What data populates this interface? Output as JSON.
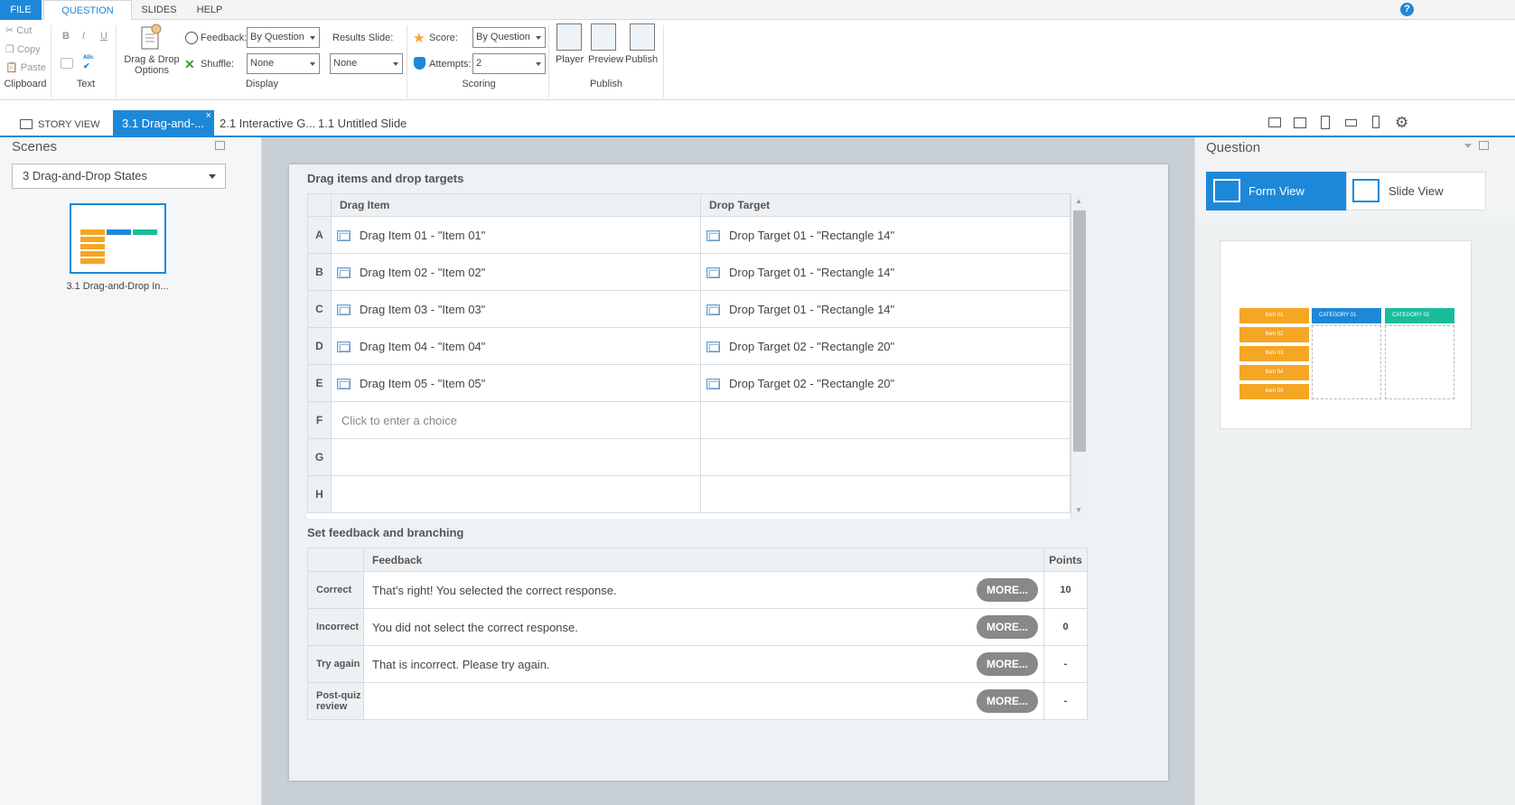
{
  "menu": {
    "file": "FILE",
    "question": "QUESTION",
    "slides": "SLIDES",
    "help": "HELP",
    "help_icon": "?"
  },
  "ribbon": {
    "clipboard": {
      "cut": "Cut",
      "copy": "Copy",
      "paste": "Paste",
      "label": "Clipboard"
    },
    "text": {
      "bold": "B",
      "italic": "I",
      "underline": "U",
      "label": "Text"
    },
    "display": {
      "dnd_line1": "Drag & Drop",
      "dnd_line2": "Options",
      "feedback_label": "Feedback:",
      "feedback_value": "By Question",
      "shuffle_label": "Shuffle:",
      "shuffle_value": "None",
      "results_label": "Results Slide:",
      "results_value": "None",
      "label": "Display"
    },
    "scoring": {
      "score_label": "Score:",
      "score_value": "By Question",
      "attempts_label": "Attempts:",
      "attempts_value": "2",
      "label": "Scoring"
    },
    "publish": {
      "player": "Player",
      "preview": "Preview",
      "publish": "Publish",
      "label": "Publish"
    }
  },
  "tabs": {
    "story_view": "STORY VIEW",
    "tab1": "3.1 Drag-and-...",
    "tab2": "2.1 Interactive G...",
    "tab3": "1.1 Untitled Slide"
  },
  "scenes": {
    "title": "Scenes",
    "dropdown": "3 Drag-and-Drop States",
    "thumb_label": "3.1 Drag-and-Drop In..."
  },
  "drag": {
    "section_title": "Drag items and drop targets",
    "col_item": "Drag Item",
    "col_target": "Drop Target",
    "rows": [
      {
        "letter": "A",
        "item": "Drag Item 01 - \"Item 01\"",
        "target": "Drop Target 01 - \"Rectangle 14\""
      },
      {
        "letter": "B",
        "item": "Drag Item 02 - \"Item 02\"",
        "target": "Drop Target 01 - \"Rectangle 14\""
      },
      {
        "letter": "C",
        "item": "Drag Item 03 - \"Item 03\"",
        "target": "Drop Target 01 - \"Rectangle 14\""
      },
      {
        "letter": "D",
        "item": "Drag Item 04 - \"Item 04\"",
        "target": "Drop Target 02 - \"Rectangle 20\""
      },
      {
        "letter": "E",
        "item": "Drag Item 05 - \"Item 05\"",
        "target": "Drop Target 02 - \"Rectangle 20\""
      },
      {
        "letter": "F",
        "item": "Click to enter a choice",
        "target": ""
      },
      {
        "letter": "G",
        "item": "",
        "target": ""
      },
      {
        "letter": "H",
        "item": "",
        "target": ""
      }
    ]
  },
  "feedback": {
    "section_title": "Set feedback and branching",
    "col_feedback": "Feedback",
    "col_points": "Points",
    "more": "MORE...",
    "rows": [
      {
        "label": "Correct",
        "text": "That's right! You selected the correct response.",
        "points": "10"
      },
      {
        "label": "Incorrect",
        "text": "You did not select the correct response.",
        "points": "0"
      },
      {
        "label": "Try again",
        "text": "That is incorrect. Please try again.",
        "points": "-"
      },
      {
        "label": "Post-quiz review",
        "text": "",
        "points": "-"
      }
    ]
  },
  "question": {
    "title": "Question",
    "form_view": "Form View",
    "slide_view": "Slide View",
    "preview": {
      "item1": "Item 01",
      "item2": "Item 02",
      "item3": "Item 03",
      "item4": "Item 04",
      "item5": "Item 05",
      "cat1": "CATEGORY 01",
      "cat2": "CATEGORY 02"
    }
  },
  "colors": {
    "accent": "#1e88d8",
    "orange": "#f5a623",
    "teal": "#1abc9c"
  }
}
